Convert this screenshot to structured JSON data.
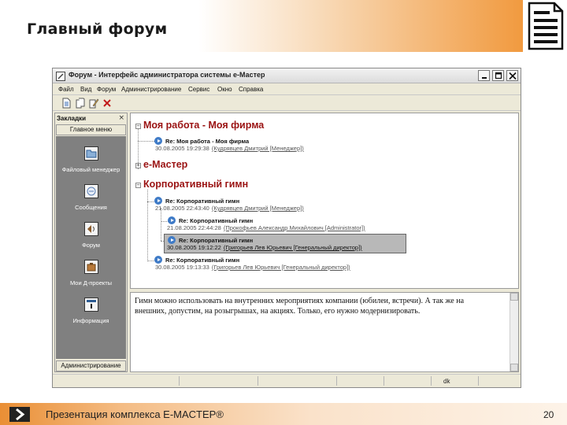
{
  "slide": {
    "title": "Главный форум",
    "footer_text": "Презентация комплекса E-MACTEP®",
    "page_number": "20"
  },
  "window": {
    "title": "Форум - Интерфейс администратора системы e-Мастер"
  },
  "menu": [
    "Файл",
    "Вид",
    "Форум",
    "Администрирование",
    "Сервис",
    "Окно",
    "Справка"
  ],
  "toolbar_icons": [
    "new-document-icon",
    "copy-icon",
    "edit-icon",
    "delete-icon"
  ],
  "sidebar": {
    "header": "Закладки",
    "close_glyph": "×",
    "main_menu": "Главное меню",
    "items": [
      {
        "label": "Файловый менеджер",
        "icon": "folder-icon"
      },
      {
        "label": "Сообщения",
        "icon": "messages-icon"
      },
      {
        "label": "Форум",
        "icon": "forum-icon"
      },
      {
        "label": "Мои Д-проекты",
        "icon": "projects-icon"
      },
      {
        "label": "Информация",
        "icon": "info-icon"
      }
    ],
    "admin_button": "Администрирование"
  },
  "threads": {
    "topic1": {
      "title": "Моя работа - Моя фирма",
      "toggle": "−",
      "messages": [
        {
          "subject": "Re: Моя работа - Моя фирма",
          "datetime": "30.08.2005 19:29:38",
          "author": "(Кудрявцев Дмитрий [Менеджер])"
        }
      ]
    },
    "topic2": {
      "title": "e-Мастер",
      "toggle": "+"
    },
    "topic3": {
      "title": "Корпоративный гимн",
      "toggle": "−",
      "messages": [
        {
          "subject": "Re: Корпоративный гимн",
          "datetime": "21.08.2005 22:43:40",
          "author": "(Кудрявцев Дмитрий [Менеджер])"
        },
        {
          "subject": "Re: Корпоративный гимн",
          "datetime": "21.08.2005 22:44:28",
          "author": "(Прокофьев Александр Михайлович [Administrator])"
        },
        {
          "subject": "Re: Корпоративный гимн",
          "datetime": "30.08.2005 19:12:22",
          "author": "(Григорьев Лев Юрьевич [Генеральный директор])",
          "selected": true
        },
        {
          "subject": "Re: Корпоративный гимн",
          "datetime": "30.08.2005 19:13:33",
          "author": "(Григорьев Лев Юрьевич [Генеральный директор])"
        }
      ]
    }
  },
  "preview_text": "Гимн можно использовать на внутренних мероприятиях компании (юбилеи, встречи). А так же на внешних, допустим, на розыгрышах, на акциях. Только, его нужно модернизировать.",
  "status_bar": {
    "user": "dk"
  },
  "colors": {
    "topic_title": "#9a1212",
    "sidebar_panel": "#808080",
    "header_accent": "#f19a3f"
  }
}
